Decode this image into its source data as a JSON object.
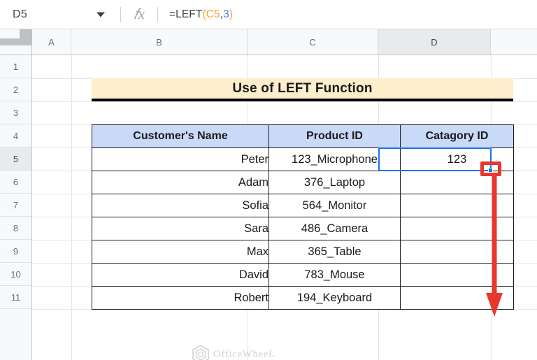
{
  "formula_bar": {
    "name_box_value": "D5",
    "fx_icon": "fx-icon",
    "formula": "=LEFT(C5,3)",
    "formula_tokens": {
      "fn": "=LEFT",
      "open_paren": "(",
      "ref": "C5",
      "comma": ",",
      "num": "3",
      "close_paren": ")"
    }
  },
  "grid": {
    "column_headers": [
      "A",
      "B",
      "C",
      "D"
    ],
    "active_column": "D",
    "row_headers": [
      "1",
      "2",
      "3",
      "4",
      "5",
      "6",
      "7",
      "8",
      "9",
      "10",
      "11"
    ],
    "active_row": "5"
  },
  "sheet": {
    "title": "Use of LEFT Function",
    "table_headers": [
      "Customer's Name",
      "Product ID",
      "Catagory ID"
    ],
    "rows": [
      {
        "name": "Peter",
        "product_id": "123_Microphone",
        "category_id": "123"
      },
      {
        "name": "Adam",
        "product_id": "376_Laptop",
        "category_id": ""
      },
      {
        "name": "Sofia",
        "product_id": "564_Monitor",
        "category_id": ""
      },
      {
        "name": "Sara",
        "product_id": "486_Camera",
        "category_id": ""
      },
      {
        "name": "Max",
        "product_id": "365_Table",
        "category_id": ""
      },
      {
        "name": "David",
        "product_id": "783_Mouse",
        "category_id": ""
      },
      {
        "name": "Robert",
        "product_id": "194_Keyboard",
        "category_id": ""
      }
    ]
  },
  "watermark": {
    "text": "OfficeWheeL"
  },
  "colors": {
    "title_fill": "#fdeecc",
    "header_fill": "#c9daf8",
    "selection": "#1a73e8",
    "annotation": "#e8372c",
    "formula_ref": "#f9a03a",
    "formula_num": "#4285f4"
  }
}
